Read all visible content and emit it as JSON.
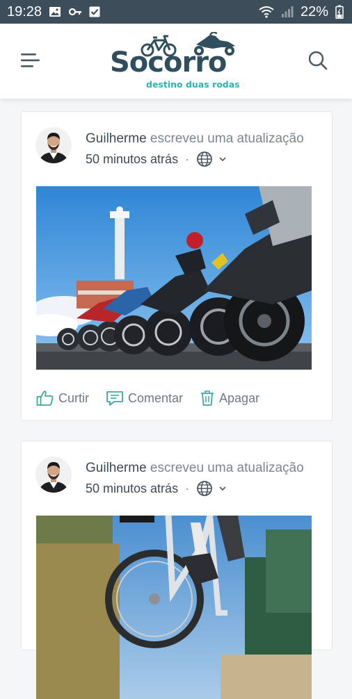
{
  "status_bar": {
    "time": "19:28",
    "battery": "22%",
    "left_icons": [
      "image-icon",
      "key-icon",
      "check-icon"
    ],
    "right_icons": [
      "wifi-icon",
      "signal-icon",
      "battery-icon"
    ]
  },
  "app_bar": {
    "logo_title": "Socorro",
    "logo_subtitle": "destino duas rodas",
    "menu_icon": "menu-icon",
    "search_icon": "search-icon"
  },
  "posts": [
    {
      "author": "Guilherme",
      "action_text": " escreveu uma atualização",
      "time": "50 minutos atrás",
      "separator": "·",
      "visibility_icon": "globe-icon",
      "image_desc": "motorcycles",
      "actions": {
        "like": "Curtir",
        "comment": "Comentar",
        "delete": "Apagar"
      }
    },
    {
      "author": "Guilherme",
      "action_text": " escreveu uma atualização",
      "time": "50 minutos atrás",
      "separator": "·",
      "visibility_icon": "globe-icon",
      "image_desc": "bicycle"
    }
  ],
  "colors": {
    "status_bar": "#3d4d5a",
    "brand_dark": "#2f4f5e",
    "brand_accent": "#2ab3b1",
    "action_icon": "#3aa99f"
  }
}
